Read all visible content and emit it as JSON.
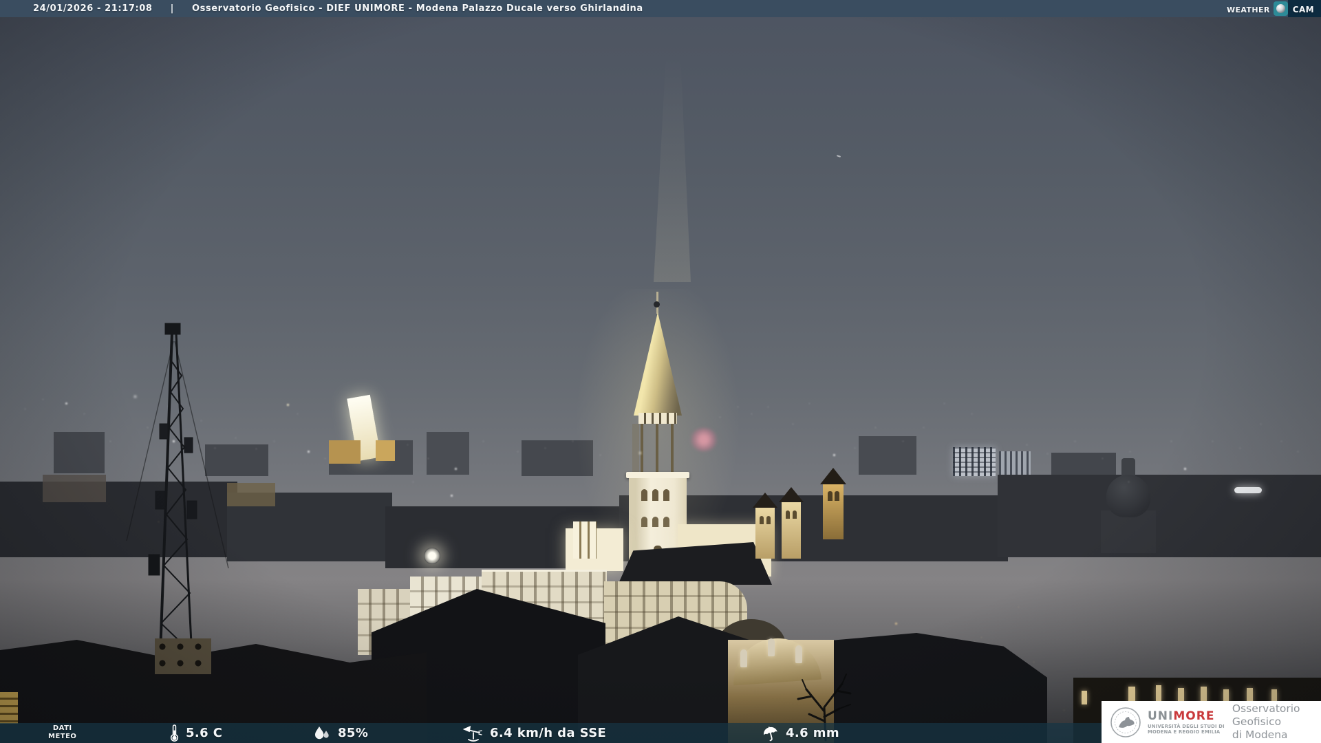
{
  "colors": {
    "top_bar_bg": "#3a4d60",
    "bottom_bar_bg": "rgba(22,52,68,0.72)",
    "cam_box_bg": "#0d2b40",
    "logo_teal": "#2d8b98",
    "unimore_red": "#c9393b",
    "overlay_text": "#f4f7f9"
  },
  "top_bar": {
    "datetime": "24/01/2026 - 21:17:08",
    "separator": "|",
    "title": "Osservatorio Geofisico - DIEF UNIMORE - Modena Palazzo Ducale verso Ghirlandina"
  },
  "weathercam": {
    "weather": "Weather",
    "cam": "Cam"
  },
  "weather_bar": {
    "label_line1": "DATI",
    "label_line2": "METEO",
    "temperature": "5.6 C",
    "humidity": "85%",
    "wind": "6.4 km/h da SSE",
    "rain": "4.6 mm"
  },
  "logo_card": {
    "brand_uni": "UNI",
    "brand_more": "MORE",
    "dept_line1": "UNIVERSITÀ DEGLI STUDI DI",
    "dept_line2": "MODENA E REGGIO EMILIA",
    "org_line1": "Osservatorio Geofisico",
    "org_line2": "di Modena"
  }
}
